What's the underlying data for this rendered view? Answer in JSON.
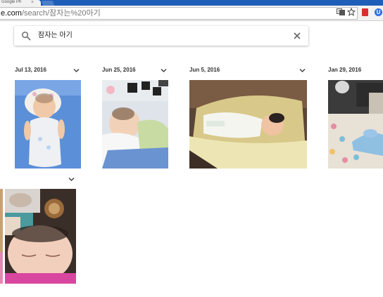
{
  "browser": {
    "tab_title": "Google Ph",
    "tab_close": "×",
    "url_host": "e.com",
    "url_path": "/search/잠자는%20아기",
    "translate_icon": "translate-icon",
    "bookmark_icon": "star-icon",
    "extensions": [
      "red-book-extension-icon",
      "blue-extension-icon"
    ],
    "blue_ext_glyph": "U"
  },
  "search": {
    "query": "잠자는 아기",
    "icon": "search-icon",
    "clear_icon": "close-icon"
  },
  "groups": [
    {
      "date": "Jul 13, 2016"
    },
    {
      "date": "Jun 25, 2016"
    },
    {
      "date": "Jun 5, 2016"
    },
    {
      "date": "Jan 29, 2016"
    }
  ],
  "colors": {
    "tabstrip": "#1e5eb8",
    "chrome": "#f2f2f2",
    "text_primary": "#333333",
    "icon_gray": "#757575"
  }
}
